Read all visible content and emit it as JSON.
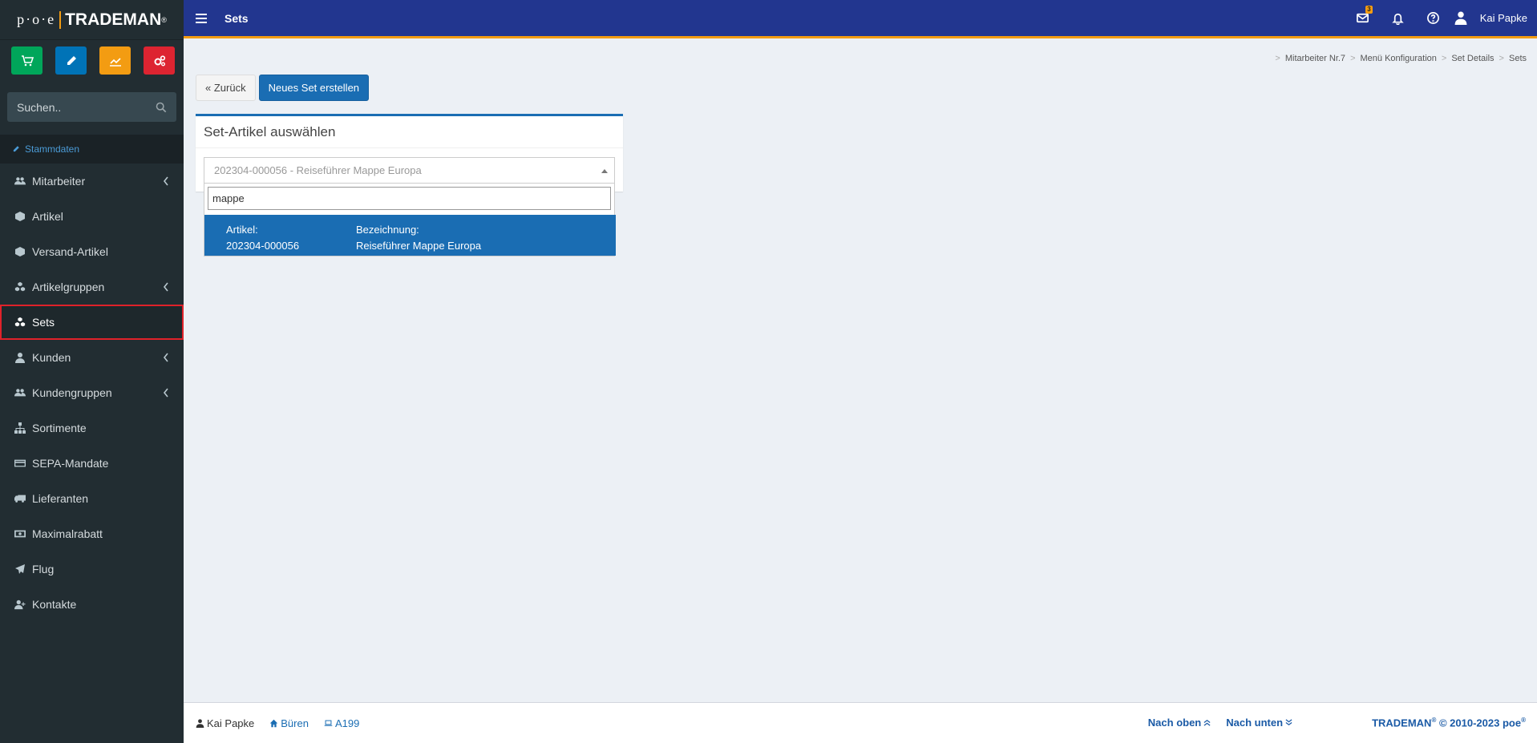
{
  "logo": {
    "prefix": "p·o·e",
    "brand": "TRADEMAN",
    "reg": "®"
  },
  "quick_buttons": [
    {
      "name": "cart",
      "color": "#00a65a"
    },
    {
      "name": "pencil",
      "color": "#0073b7"
    },
    {
      "name": "chart",
      "color": "#f39c12"
    },
    {
      "name": "cogs",
      "color": "#dd2431"
    }
  ],
  "search": {
    "placeholder": "Suchen.."
  },
  "sidebar": {
    "section": "Stammdaten",
    "items": [
      {
        "label": "Mitarbeiter",
        "icon": "users-icon",
        "has_children": true
      },
      {
        "label": "Artikel",
        "icon": "cube-icon",
        "has_children": false
      },
      {
        "label": "Versand-Artikel",
        "icon": "cube-icon",
        "has_children": false
      },
      {
        "label": "Artikelgruppen",
        "icon": "cubes-icon",
        "has_children": true
      },
      {
        "label": "Sets",
        "icon": "cubes-icon",
        "has_children": false,
        "active": true
      },
      {
        "label": "Kunden",
        "icon": "user-icon",
        "has_children": true
      },
      {
        "label": "Kundengruppen",
        "icon": "users-icon",
        "has_children": true
      },
      {
        "label": "Sortimente",
        "icon": "sitemap-icon",
        "has_children": false
      },
      {
        "label": "SEPA-Mandate",
        "icon": "credit-card-icon",
        "has_children": false
      },
      {
        "label": "Lieferanten",
        "icon": "truck-icon",
        "has_children": false
      },
      {
        "label": "Maximalrabatt",
        "icon": "money-icon",
        "has_children": false
      },
      {
        "label": "Flug",
        "icon": "plane-icon",
        "has_children": false
      },
      {
        "label": "Kontakte",
        "icon": "user-plus-icon",
        "has_children": false
      }
    ]
  },
  "navbar": {
    "title": "Sets",
    "mail_badge": "3",
    "user_name": "Kai Papke"
  },
  "breadcrumb": [
    "Mitarbeiter Nr.7",
    "Menü Konfiguration",
    "Set Details",
    "Sets"
  ],
  "actions": {
    "back": "« Zurück",
    "new_set": "Neues Set erstellen"
  },
  "box": {
    "title": "Set-Artikel auswählen",
    "select_value": "202304-000056 - Reiseführer Mappe Europa",
    "search_value": "mappe",
    "option": {
      "label_article": "Artikel:",
      "article": "202304-000056",
      "label_desc": "Bezeichnung:",
      "desc": "Reiseführer Mappe Europa"
    }
  },
  "footer": {
    "user": "Kai Papke",
    "location": "Büren",
    "workstation": "A199",
    "nach_oben": "Nach oben",
    "nach_unten": "Nach unten",
    "copyright_brand": "TRADEMAN",
    "copyright_text": "© 2010-2023",
    "copyright_company": "poe",
    "reg": "®"
  }
}
